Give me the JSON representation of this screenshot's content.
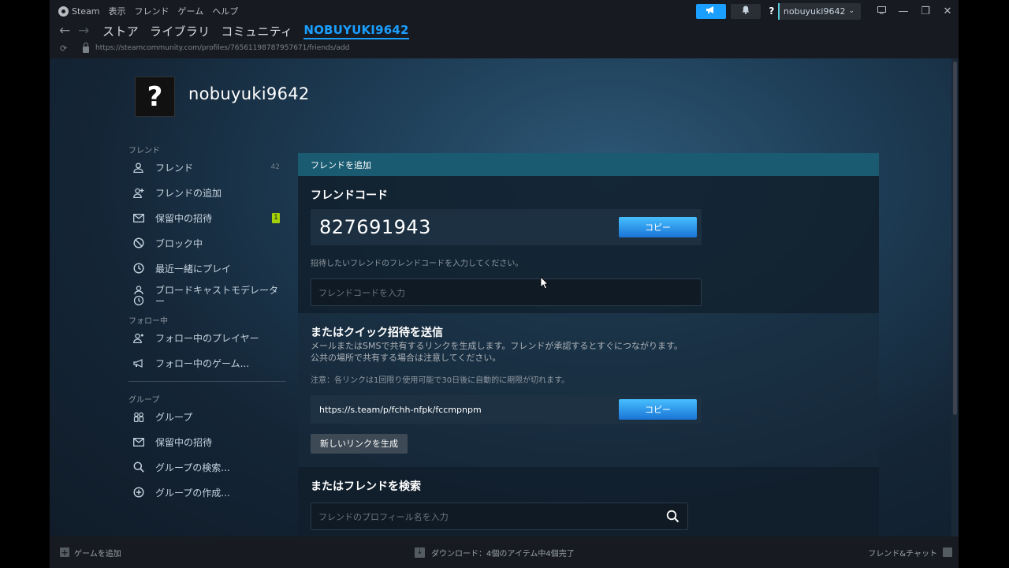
{
  "menubar": {
    "logo_label": "Steam",
    "items": [
      "表示",
      "フレンド",
      "ゲーム",
      "ヘルプ"
    ],
    "account_name": "nobuyuki9642",
    "avatar_glyph": "?"
  },
  "nav": {
    "links": [
      "ストア",
      "ライブラリ",
      "コミュニティ"
    ],
    "active_link": "NOBUYUKI9642"
  },
  "url": "https://steamcommunity.com/profiles/76561198787957671/friends/add",
  "profile": {
    "avatar_glyph": "?",
    "name": "nobuyuki9642"
  },
  "sidebar": {
    "friends_section": "フレンド",
    "friends_items": [
      {
        "label": "フレンド",
        "icon": "person-icon",
        "count": "42"
      },
      {
        "label": "フレンドの追加",
        "icon": "add-person-icon"
      },
      {
        "label": "保留中の招待",
        "icon": "envelope-icon",
        "badge": "1"
      },
      {
        "label": "ブロック中",
        "icon": "block-icon"
      },
      {
        "label": "最近一緒にプレイ",
        "icon": "clock-icon"
      },
      {
        "label": "ブロードキャストモデレーター",
        "icon": "person-clock-icon"
      }
    ],
    "following_section": "フォロー中",
    "following_items": [
      {
        "label": "フォロー中のプレイヤー",
        "icon": "follow-person-icon"
      },
      {
        "label": "フォロー中のゲーム...",
        "icon": "megaphone-icon"
      }
    ],
    "groups_section": "グループ",
    "groups_items": [
      {
        "label": "グループ",
        "icon": "group-icon"
      },
      {
        "label": "保留中の招待",
        "icon": "envelope-icon"
      },
      {
        "label": "グループの検索...",
        "icon": "search-icon"
      },
      {
        "label": "グループの作成...",
        "icon": "plus-circle-icon"
      }
    ]
  },
  "panel": {
    "header": "フレンドを追加",
    "friend_code_title": "フレンドコード",
    "friend_code": "827691943",
    "copy_label": "コピー",
    "hint": "招待したいフレンドのフレンドコードを入力してください。",
    "code_placeholder": "フレンドコードを入力",
    "quick_title": "またはクイック招待を送信",
    "quick_desc_1": "メールまたはSMSで共有するリンクを生成します。フレンドが承認するとすぐにつながります。",
    "quick_desc_2": "公共の場所で共有する場合は注意してください。",
    "quick_note": "注意：各リンクは1回限り使用可能で30日後に自動的に期限が切れます。",
    "invite_link": "https://s.team/p/fchh-nfpk/fccmpnpm",
    "new_link_label": "新しいリンクを生成",
    "search_title": "またはフレンドを検索",
    "search_placeholder": "フレンドのプロフィール名を入力"
  },
  "bottombar": {
    "add_game": "ゲームを追加",
    "downloads": "ダウンロード：4個のアイテム中4個完了",
    "friends_chat": "フレンド&チャット"
  },
  "colors": {
    "accent": "#1a9fff",
    "header_teal": "#1a5b72",
    "badge_green": "#a4d007"
  }
}
